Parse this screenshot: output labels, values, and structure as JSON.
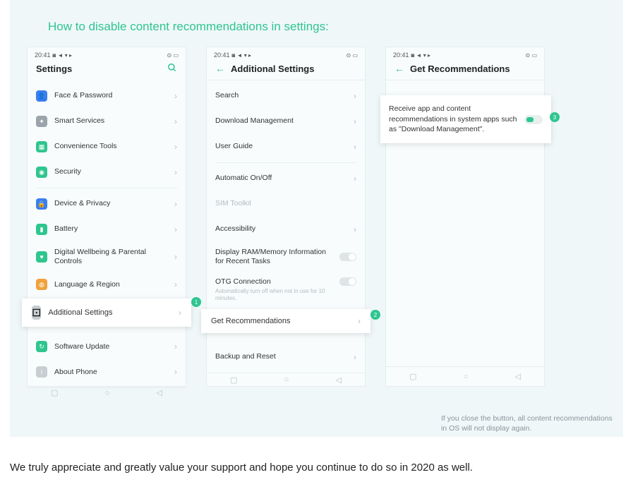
{
  "title": "How to disable content recommendations in settings:",
  "status": {
    "time": "20:41",
    "icons_left": "◙ ◄ ▾ ▸",
    "icons_right": "⊙ ▭"
  },
  "phone1": {
    "header": "Settings",
    "rows": [
      {
        "label": "Face & Password",
        "icon": "user-icon",
        "color": "ic-blue"
      },
      {
        "label": "Smart Services",
        "icon": "gear-icon",
        "color": "ic-grey"
      },
      {
        "label": "Convenience Tools",
        "icon": "tools-icon",
        "color": "ic-green"
      },
      {
        "label": "Security",
        "icon": "shield-icon",
        "color": "ic-green"
      },
      {
        "label": "Device & Privacy",
        "icon": "privacy-icon",
        "color": "ic-blue"
      },
      {
        "label": "Battery",
        "icon": "battery-icon",
        "color": "ic-green"
      },
      {
        "label": "Digital Wellbeing & Parental Controls",
        "icon": "wellbeing-icon",
        "color": "ic-green"
      },
      {
        "label": "Language & Region",
        "icon": "globe-icon",
        "color": "ic-orange"
      }
    ],
    "highlight": "Additional Settings",
    "after": [
      {
        "label": "Software Update",
        "icon": "update-icon",
        "color": "ic-green"
      },
      {
        "label": "About Phone",
        "icon": "info-icon",
        "color": "ic-lgrey"
      }
    ]
  },
  "phone2": {
    "header": "Additional Settings",
    "rows1": [
      {
        "label": "Search"
      },
      {
        "label": "Download Management"
      },
      {
        "label": "User Guide"
      }
    ],
    "rows2": [
      {
        "label": "Automatic On/Off"
      },
      {
        "label": "SIM Toolkit",
        "muted": true
      },
      {
        "label": "Accessibility"
      }
    ],
    "ram": {
      "label": "Display RAM/Memory Information for Recent Tasks"
    },
    "otg": {
      "label": "OTG Connection",
      "sub": "Automatically turn off when not in use for 10 minutes."
    },
    "highlight": "Get Recommendations",
    "after": [
      {
        "label": "Backup and Reset"
      }
    ]
  },
  "phone3": {
    "header": "Get Recommendations",
    "rec_text": "Receive app and content recommendations in system apps such as \"Download Management\"."
  },
  "markers": {
    "m1": "1",
    "m2": "2",
    "m3": "3"
  },
  "caption": "If you close the button, all content recommendations in OS will not display again.",
  "footer": "We truly appreciate and greatly value your support and hope you continue to do so in 2020 as well."
}
